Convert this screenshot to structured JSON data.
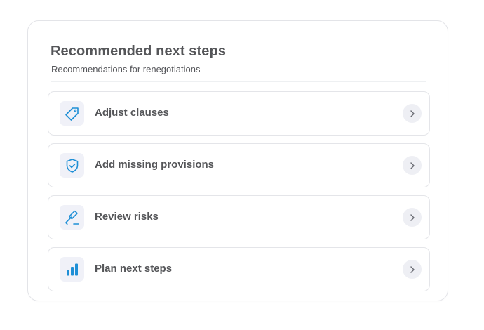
{
  "panel": {
    "title": "Recommended next steps",
    "subtitle": "Recommendations for renegotiations"
  },
  "items": [
    {
      "label": "Adjust clauses",
      "icon": "tag-icon"
    },
    {
      "label": "Add missing provisions",
      "icon": "shield-check-icon"
    },
    {
      "label": "Review risks",
      "icon": "gavel-icon"
    },
    {
      "label": "Plan next steps",
      "icon": "bar-chart-icon"
    }
  ],
  "colors": {
    "accent": "#1e8fd6",
    "text": "#555659",
    "icon_tile": "#f0f1f8",
    "border": "#e4e5e9"
  }
}
